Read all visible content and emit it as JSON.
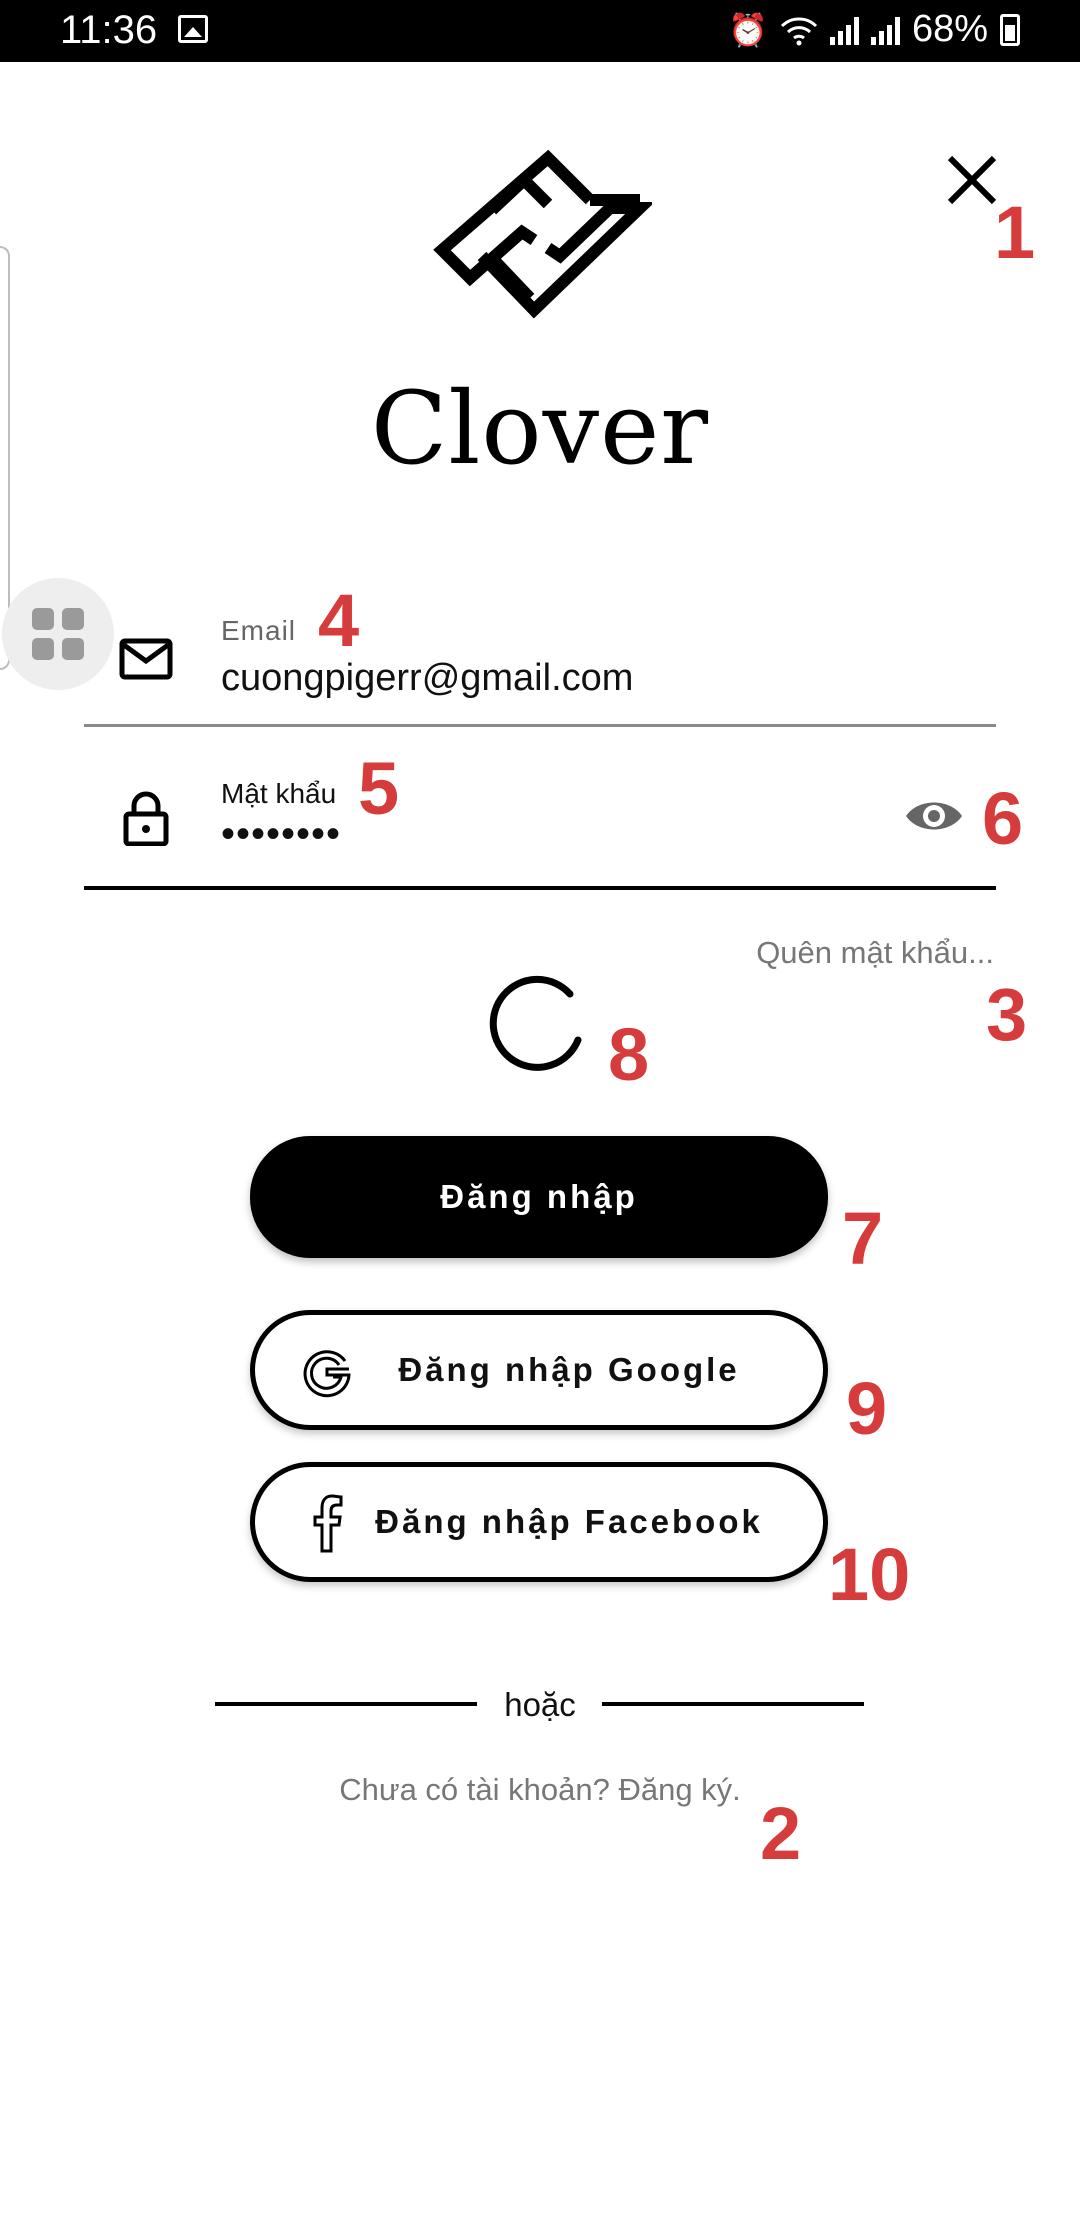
{
  "status_bar": {
    "time": "11:36",
    "battery": "68%",
    "icons": [
      "gallery-icon",
      "alarm-icon",
      "wifi-icon",
      "signal-icon",
      "battery-icon"
    ]
  },
  "header": {
    "brand": "Clover",
    "logo_icon": "clover-logo-icon",
    "close_icon": "close-icon"
  },
  "form": {
    "email": {
      "label": "Email",
      "value": "cuongpigerr@gmail.com",
      "icon": "mail-icon"
    },
    "password": {
      "label": "Mật khẩu",
      "value": "••••••••",
      "icon": "lock-icon",
      "toggle_icon": "eye-icon"
    },
    "forgot": "Quên mật khẩu..."
  },
  "loading": {
    "icon": "spinner-icon"
  },
  "buttons": {
    "login": "Đăng nhập",
    "google": "Đăng nhập Google",
    "facebook": "Đăng nhập Facebook"
  },
  "divider": "hoặc",
  "signup": "Chưa có tài khoản? Đăng ký.",
  "annotations": [
    "1",
    "2",
    "3",
    "4",
    "5",
    "6",
    "7",
    "8",
    "9",
    "10"
  ],
  "colors": {
    "primary": "#000000",
    "background": "#ffffff",
    "muted_text": "#777777",
    "annotation": "#d63c3c"
  }
}
